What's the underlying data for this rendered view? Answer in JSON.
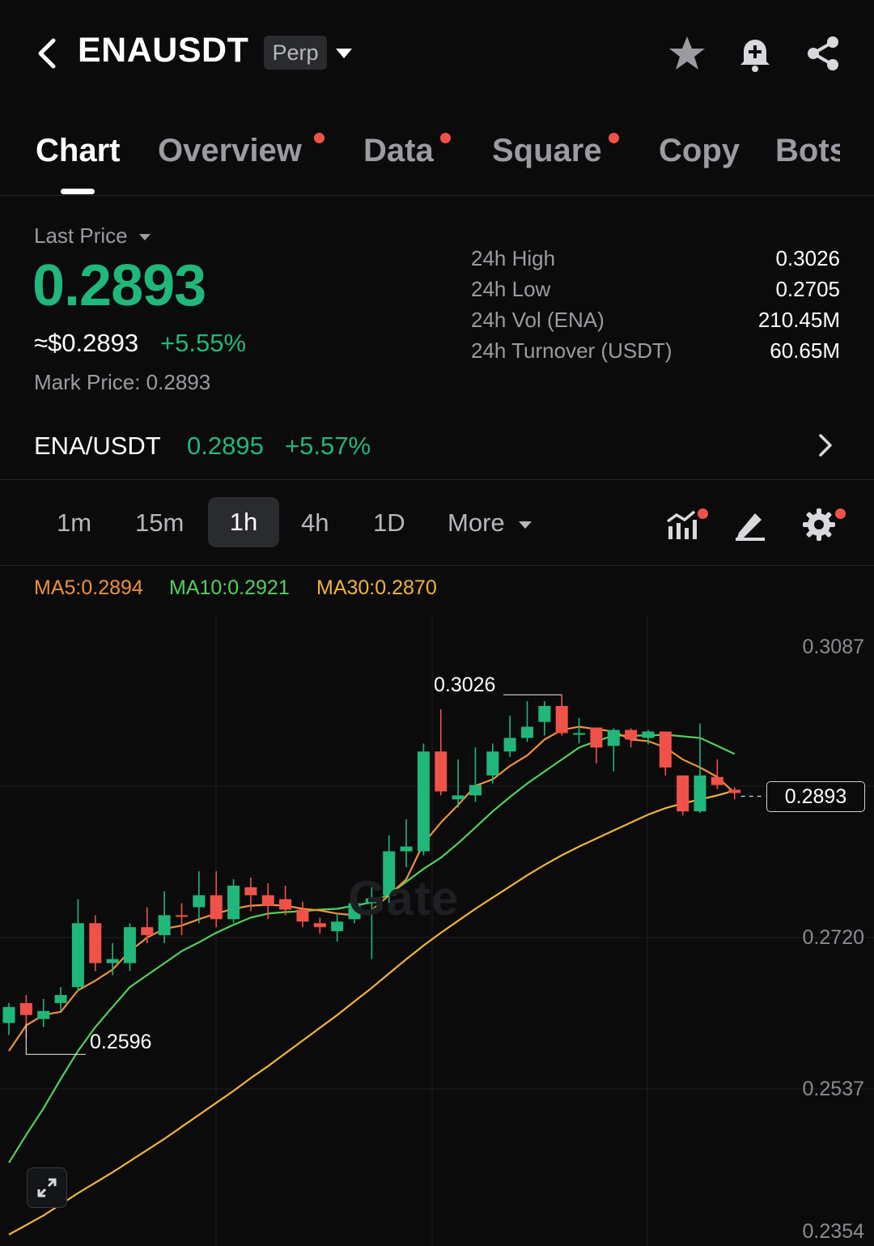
{
  "header": {
    "symbol": "ENAUSDT",
    "contract_type": "Perp",
    "icons": [
      "back-icon",
      "caret-down-icon",
      "star-icon",
      "bell-plus-icon",
      "share-icon"
    ]
  },
  "tabs": [
    {
      "label": "Chart",
      "active": true,
      "dot": false
    },
    {
      "label": "Overview",
      "active": false,
      "dot": true
    },
    {
      "label": "Data",
      "active": false,
      "dot": true
    },
    {
      "label": "Square",
      "active": false,
      "dot": true
    },
    {
      "label": "Copy",
      "active": false,
      "dot": false
    },
    {
      "label": "Bots",
      "active": false,
      "dot": false
    }
  ],
  "price": {
    "last_price_label": "Last Price",
    "last_price": "0.2893",
    "usd_approx": "≈$0.2893",
    "change_pct": "+5.55%",
    "mark_price": "Mark Price:  0.2893"
  },
  "stats": [
    {
      "label": "24h High",
      "value": "0.3026"
    },
    {
      "label": "24h Low",
      "value": "0.2705"
    },
    {
      "label": "24h Vol (ENA)",
      "value": "210.45M"
    },
    {
      "label": "24h Turnover (USDT)",
      "value": "60.65M"
    }
  ],
  "spot": {
    "pair": "ENA/USDT",
    "price": "0.2895",
    "change": "+5.57%"
  },
  "timeframes": {
    "items": [
      "1m",
      "15m",
      "1h",
      "4h",
      "1D"
    ],
    "active": "1h",
    "more_label": "More"
  },
  "tools": [
    "indicator-icon",
    "draw-icon",
    "settings-icon"
  ],
  "ma_legend": [
    {
      "label": "MA5:0.2894",
      "color": "#f0913a"
    },
    {
      "label": "MA10:0.2921",
      "color": "#52d15a"
    },
    {
      "label": "MA30:0.2870",
      "color": "#f2b33d"
    }
  ],
  "colors": {
    "up": "#21b77a",
    "down": "#f0524a",
    "accent_dot": "#f0524a"
  },
  "chart_data": {
    "type": "candlestick",
    "interval": "1h",
    "y_axis_labels": [
      "0.3087",
      "0.2720",
      "0.2537",
      "0.2354"
    ],
    "current_price_tag": "0.2893",
    "high_marker": "0.3026",
    "low_marker": "0.2596",
    "watermark": "Gate",
    "candles": [
      {
        "o": 0.2615,
        "c": 0.2635,
        "h": 0.264,
        "l": 0.26
      },
      {
        "o": 0.264,
        "c": 0.2625,
        "h": 0.265,
        "l": 0.2596
      },
      {
        "o": 0.262,
        "c": 0.263,
        "h": 0.2645,
        "l": 0.261
      },
      {
        "o": 0.264,
        "c": 0.265,
        "h": 0.266,
        "l": 0.263
      },
      {
        "o": 0.266,
        "c": 0.274,
        "h": 0.277,
        "l": 0.2655
      },
      {
        "o": 0.274,
        "c": 0.269,
        "h": 0.275,
        "l": 0.268
      },
      {
        "o": 0.269,
        "c": 0.2695,
        "h": 0.2715,
        "l": 0.2675
      },
      {
        "o": 0.269,
        "c": 0.2735,
        "h": 0.274,
        "l": 0.268
      },
      {
        "o": 0.2735,
        "c": 0.2725,
        "h": 0.276,
        "l": 0.2715
      },
      {
        "o": 0.2725,
        "c": 0.275,
        "h": 0.278,
        "l": 0.2715
      },
      {
        "o": 0.275,
        "c": 0.2748,
        "h": 0.2765,
        "l": 0.2725
      },
      {
        "o": 0.276,
        "c": 0.2775,
        "h": 0.2805,
        "l": 0.274
      },
      {
        "o": 0.2775,
        "c": 0.2745,
        "h": 0.2805,
        "l": 0.2735
      },
      {
        "o": 0.2745,
        "c": 0.2787,
        "h": 0.2795,
        "l": 0.274
      },
      {
        "o": 0.2785,
        "c": 0.2775,
        "h": 0.2797,
        "l": 0.2755
      },
      {
        "o": 0.2775,
        "c": 0.2762,
        "h": 0.279,
        "l": 0.2745
      },
      {
        "o": 0.277,
        "c": 0.2757,
        "h": 0.2787,
        "l": 0.275
      },
      {
        "o": 0.2757,
        "c": 0.2742,
        "h": 0.2767,
        "l": 0.2735
      },
      {
        "o": 0.274,
        "c": 0.2735,
        "h": 0.2747,
        "l": 0.2727
      },
      {
        "o": 0.273,
        "c": 0.2742,
        "h": 0.2752,
        "l": 0.2717
      },
      {
        "o": 0.2745,
        "c": 0.2765,
        "h": 0.2772,
        "l": 0.274
      },
      {
        "o": 0.2765,
        "c": 0.2771,
        "h": 0.2785,
        "l": 0.2695
      },
      {
        "o": 0.2775,
        "c": 0.283,
        "h": 0.285,
        "l": 0.2765
      },
      {
        "o": 0.283,
        "c": 0.2836,
        "h": 0.287,
        "l": 0.281
      },
      {
        "o": 0.283,
        "c": 0.2955,
        "h": 0.2965,
        "l": 0.2825
      },
      {
        "o": 0.2955,
        "c": 0.2905,
        "h": 0.3008,
        "l": 0.29
      },
      {
        "o": 0.2895,
        "c": 0.29,
        "h": 0.2945,
        "l": 0.2885
      },
      {
        "o": 0.29,
        "c": 0.2913,
        "h": 0.296,
        "l": 0.2892
      },
      {
        "o": 0.2925,
        "c": 0.2955,
        "h": 0.2965,
        "l": 0.2915
      },
      {
        "o": 0.2955,
        "c": 0.2972,
        "h": 0.3,
        "l": 0.2948
      },
      {
        "o": 0.2972,
        "c": 0.2986,
        "h": 0.3018,
        "l": 0.2967
      },
      {
        "o": 0.2992,
        "c": 0.3012,
        "h": 0.3018,
        "l": 0.2975
      },
      {
        "o": 0.3012,
        "c": 0.2978,
        "h": 0.3026,
        "l": 0.2975
      },
      {
        "o": 0.2978,
        "c": 0.2978,
        "h": 0.2997,
        "l": 0.2965
      },
      {
        "o": 0.2985,
        "c": 0.296,
        "h": 0.2985,
        "l": 0.294
      },
      {
        "o": 0.2962,
        "c": 0.2982,
        "h": 0.2984,
        "l": 0.293
      },
      {
        "o": 0.2982,
        "c": 0.297,
        "h": 0.2984,
        "l": 0.296
      },
      {
        "o": 0.2972,
        "c": 0.298,
        "h": 0.2982,
        "l": 0.2964
      },
      {
        "o": 0.298,
        "c": 0.2935,
        "h": 0.298,
        "l": 0.2925
      },
      {
        "o": 0.2925,
        "c": 0.288,
        "h": 0.2925,
        "l": 0.2875
      },
      {
        "o": 0.288,
        "c": 0.2925,
        "h": 0.299,
        "l": 0.2878
      },
      {
        "o": 0.2923,
        "c": 0.2913,
        "h": 0.2945,
        "l": 0.2908
      },
      {
        "o": 0.2907,
        "c": 0.2903,
        "h": 0.291,
        "l": 0.2895
      }
    ],
    "ma5": [
      0.258,
      0.2612,
      0.2625,
      0.2629,
      0.2656,
      0.2668,
      0.2682,
      0.2705,
      0.2722,
      0.2733,
      0.2737,
      0.2745,
      0.2752,
      0.2758,
      0.2762,
      0.2763,
      0.2762,
      0.2758,
      0.2756,
      0.2752,
      0.275,
      0.2756,
      0.2775,
      0.2795,
      0.284,
      0.2866,
      0.2888,
      0.2912,
      0.292,
      0.2937,
      0.295,
      0.297,
      0.2982,
      0.2986,
      0.2983,
      0.298,
      0.297,
      0.2968,
      0.296,
      0.2945,
      0.2935,
      0.2923,
      0.2903
    ],
    "ma10": [
      0.244,
      0.2475,
      0.2508,
      0.2545,
      0.258,
      0.261,
      0.2635,
      0.266,
      0.2675,
      0.269,
      0.2705,
      0.2716,
      0.2728,
      0.2738,
      0.2747,
      0.2752,
      0.2754,
      0.2755,
      0.2757,
      0.2758,
      0.2762,
      0.2766,
      0.2776,
      0.2792,
      0.2808,
      0.2822,
      0.284,
      0.286,
      0.288,
      0.2898,
      0.2915,
      0.293,
      0.2945,
      0.296,
      0.2968,
      0.2975,
      0.2975,
      0.2975,
      0.2976,
      0.2974,
      0.2972,
      0.2962,
      0.2952
    ],
    "ma30": [
      0.235,
      0.2362,
      0.2374,
      0.2388,
      0.2402,
      0.2415,
      0.2428,
      0.2442,
      0.2456,
      0.247,
      0.2485,
      0.25,
      0.2515,
      0.253,
      0.2546,
      0.2561,
      0.2577,
      0.2593,
      0.2609,
      0.2625,
      0.2642,
      0.2659,
      0.2677,
      0.2695,
      0.2712,
      0.2728,
      0.2743,
      0.2758,
      0.2772,
      0.2786,
      0.28,
      0.2813,
      0.2825,
      0.2836,
      0.2846,
      0.2856,
      0.2866,
      0.2876,
      0.2884,
      0.289,
      0.2895,
      0.29,
      0.2906
    ]
  }
}
